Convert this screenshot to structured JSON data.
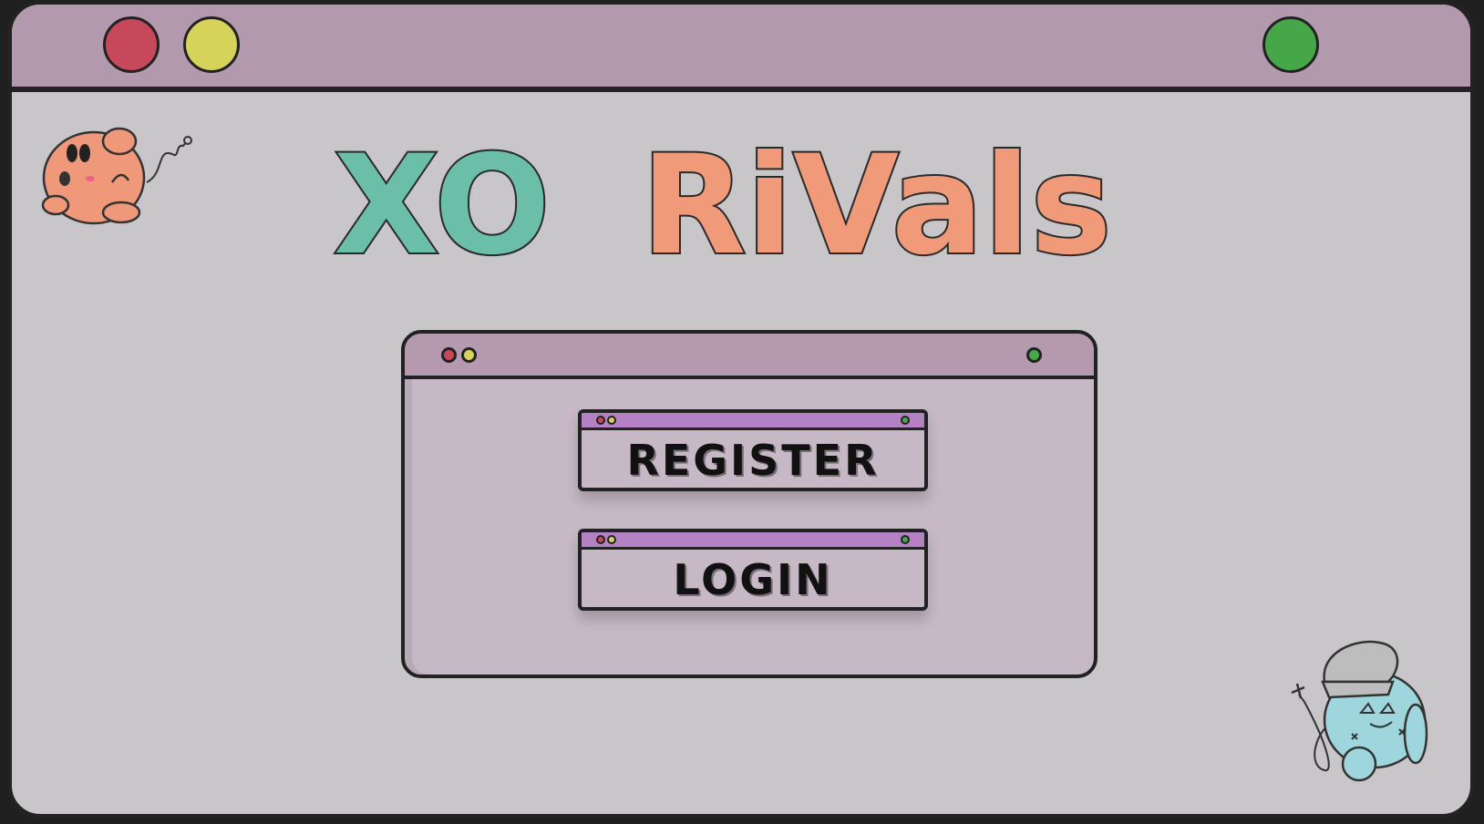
{
  "window": {
    "buttons": [
      {
        "name": "close",
        "color": "#c7485b"
      },
      {
        "name": "minimize",
        "color": "#d6d35b"
      },
      {
        "name": "maximize",
        "color": "#45a748"
      }
    ]
  },
  "title": {
    "word1": "XO",
    "word2": "RiVals"
  },
  "menu": {
    "register_label": "REGISTER",
    "login_label": "LOGIN"
  },
  "colors": {
    "teal": "#6bbfa9",
    "salmon": "#f09a7a",
    "titlebar": "#b399ae",
    "button_bar": "#b482c4",
    "background": "#c8c6c8"
  },
  "icons": {
    "top_left_mascot": "orange-blob-mascot-icon",
    "bottom_right_mascot": "blue-chef-mascot-icon"
  }
}
